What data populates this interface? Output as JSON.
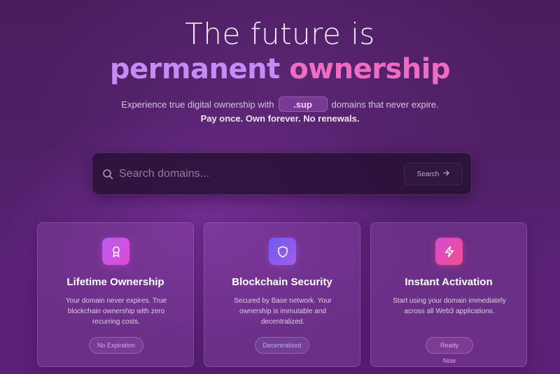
{
  "hero": {
    "line1": "The future is",
    "line2_part1": "permanent",
    "line2_part2": "ownership",
    "subtitle_before": "Experience true digital ownership with",
    "tld": ".sup",
    "subtitle_after": "domains that never expire.",
    "tagline": "Pay once. Own forever. No renewals."
  },
  "search": {
    "placeholder": "Search domains...",
    "button_label": "Search",
    "button_icon": "arrow-right-icon"
  },
  "features": [
    {
      "icon": "award-icon",
      "title": "Lifetime Ownership",
      "description": "Your domain never expires. True blockchain ownership with zero recurring costs.",
      "badge": "No Expiration",
      "icon_gradient": [
        "#b85cf0",
        "#e04ad8"
      ],
      "badge_color": "#d9a3f2"
    },
    {
      "icon": "shield-icon",
      "title": "Blockchain Security",
      "description": "Secured by Base network. Your ownership is immutable and decentralized.",
      "badge": "Decentralized",
      "icon_gradient": [
        "#6b5cf0",
        "#a55ce8"
      ],
      "badge_color": "#b9b0f5"
    },
    {
      "icon": "lightning-icon",
      "title": "Instant Activation",
      "description": "Start using your domain immediately across all Web3 applications.",
      "badge": "Ready Now",
      "icon_gradient": [
        "#d64bd8",
        "#f0508a"
      ],
      "badge_color": "#f2a3de"
    }
  ],
  "colors": {
    "accent_purple": "#c48bf4",
    "accent_pink": "#f06cc0"
  }
}
